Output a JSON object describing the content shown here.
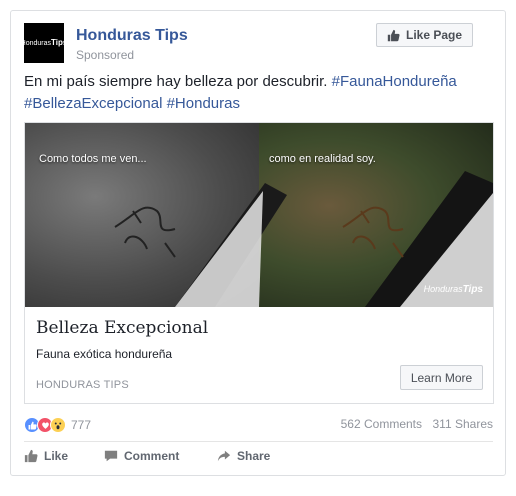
{
  "post": {
    "page_name": "Honduras Tips",
    "avatar_text_1": "Honduras",
    "avatar_text_2": "Tips",
    "sponsored_label": "Sponsored",
    "like_page_label": "Like Page",
    "text_plain": "En mi país siempre hay belleza por descubrir. ",
    "hashtags": [
      "#FaunaHondureña",
      "#BellezaExcepcional",
      "#Honduras"
    ]
  },
  "attachment": {
    "overlay_left": "Como todos me ven...",
    "overlay_right": "como en realidad soy.",
    "watermark_1": "Honduras",
    "watermark_2": "Tips",
    "title": "Belleza Excepcional",
    "description": "Fauna exótica hondureña",
    "domain": "HONDURAS TIPS",
    "cta_label": "Learn More"
  },
  "stats": {
    "reaction_icons": [
      "like-reaction-icon",
      "love-reaction-icon",
      "wow-reaction-icon"
    ],
    "reaction_count": "777",
    "comments": "562 Comments",
    "shares": "311 Shares"
  },
  "actions": {
    "like": "Like",
    "comment": "Comment",
    "share": "Share"
  },
  "colors": {
    "link": "#365899",
    "like_reaction": "#5890ff",
    "love_reaction": "#f25268",
    "wow_reaction": "#fcd054"
  }
}
